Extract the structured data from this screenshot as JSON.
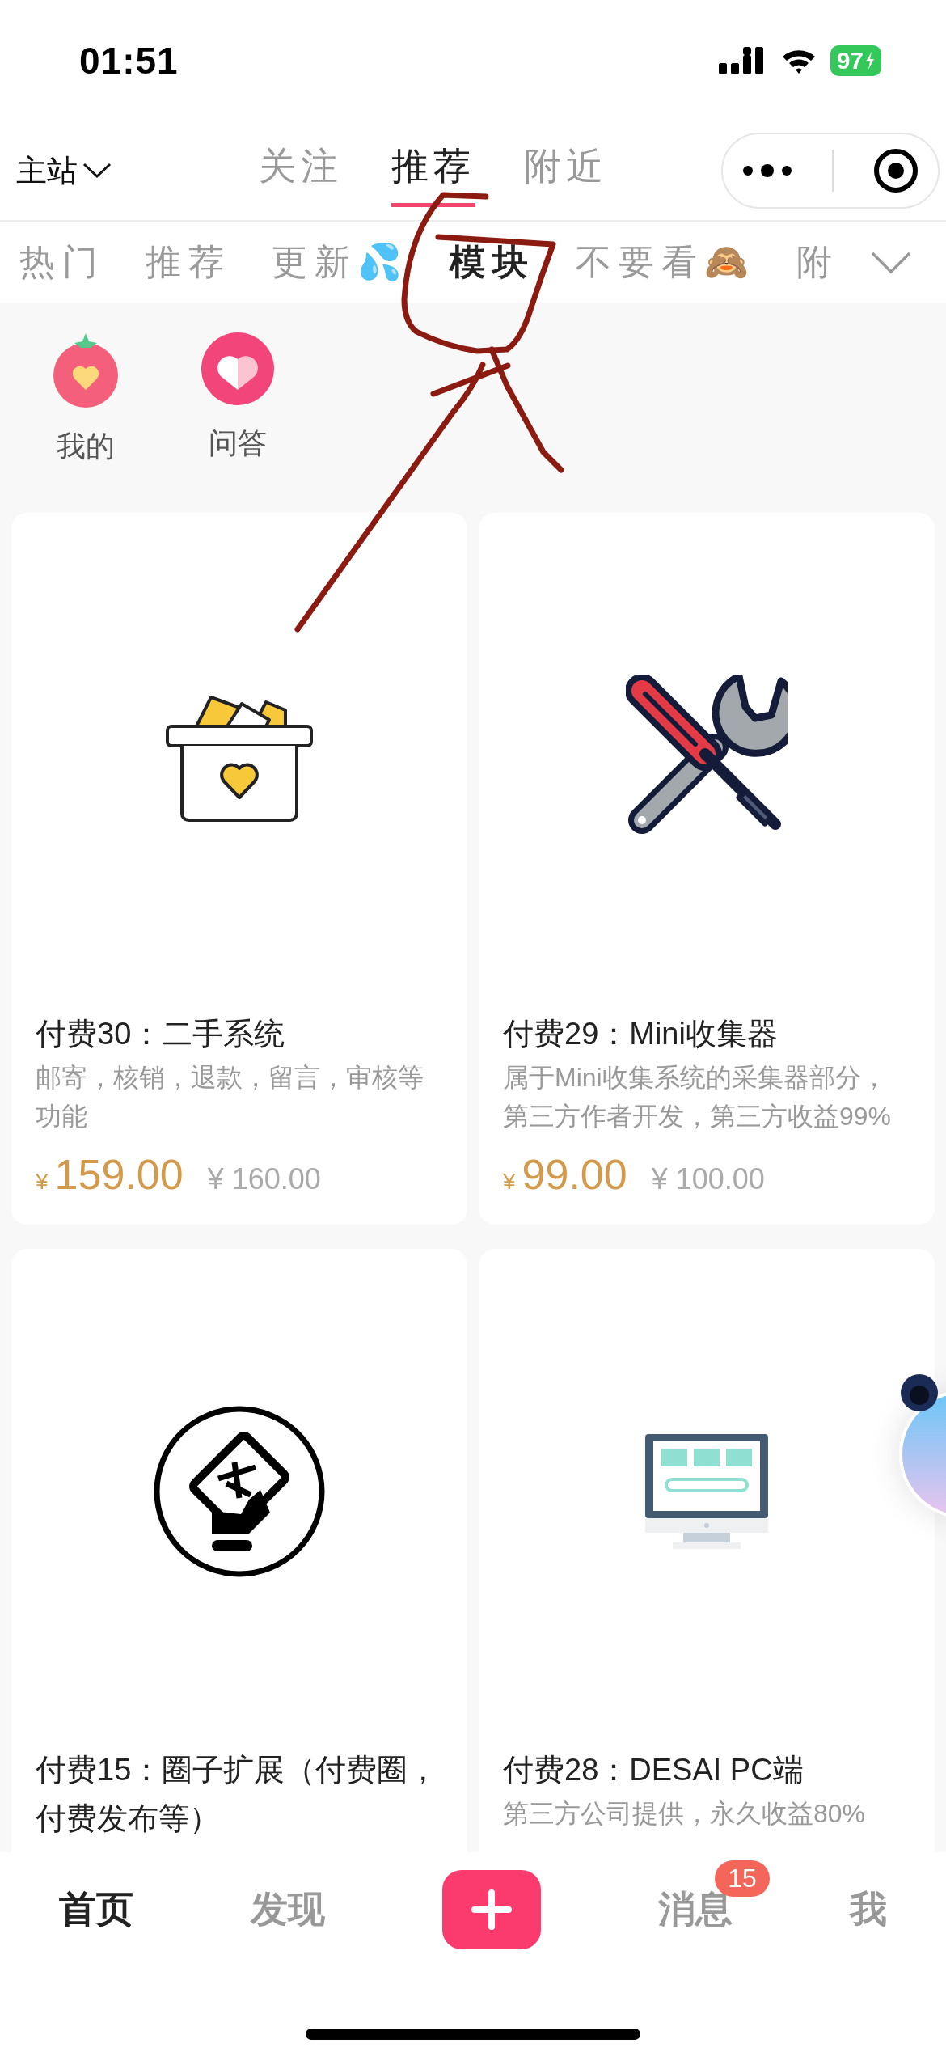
{
  "status_bar": {
    "time": "01:51",
    "battery": "97"
  },
  "top_nav": {
    "site": "主站",
    "tabs": [
      {
        "label": "关注",
        "selected": false
      },
      {
        "label": "推荐",
        "selected": true
      },
      {
        "label": "附近",
        "selected": false
      }
    ]
  },
  "categories": [
    {
      "label": "热门",
      "selected": false
    },
    {
      "label": "推荐",
      "selected": false
    },
    {
      "label": "更新💦",
      "selected": false
    },
    {
      "label": "模块",
      "selected": true
    },
    {
      "label": "不要看🙈",
      "selected": false
    },
    {
      "label": "附",
      "selected": false
    }
  ],
  "shortcuts": [
    {
      "label": "我的",
      "kind": "tomato"
    },
    {
      "label": "问答",
      "kind": "heart"
    }
  ],
  "products": [
    {
      "kind": "basket",
      "title": "付费30：二手系统",
      "description": "邮寄，核销，退款，留言，审核等功能",
      "currency": "¥",
      "price": "159.00",
      "original_price": "¥ 160.00"
    },
    {
      "kind": "tools",
      "title": "付费29：Mini收集器",
      "description": "属于Mini收集系统的采集器部分，第三方作者开发，第三方收益99%",
      "currency": "¥",
      "price": "99.00",
      "original_price": "¥ 100.00"
    },
    {
      "kind": "card",
      "title": "付费15：圈子扩展（付费圈，付费发布等）"
    },
    {
      "kind": "monitor",
      "title": "付费28：DESAI PC端",
      "description": "第三方公司提供，永久收益80%"
    }
  ],
  "bottom_nav": [
    {
      "kind": "tab",
      "label": "首页",
      "selected": true
    },
    {
      "kind": "tab",
      "label": "发现",
      "selected": false
    },
    {
      "kind": "add"
    },
    {
      "kind": "tab",
      "label": "消息",
      "selected": false,
      "badge": "15"
    },
    {
      "kind": "tab",
      "label": "我",
      "selected": false
    }
  ]
}
